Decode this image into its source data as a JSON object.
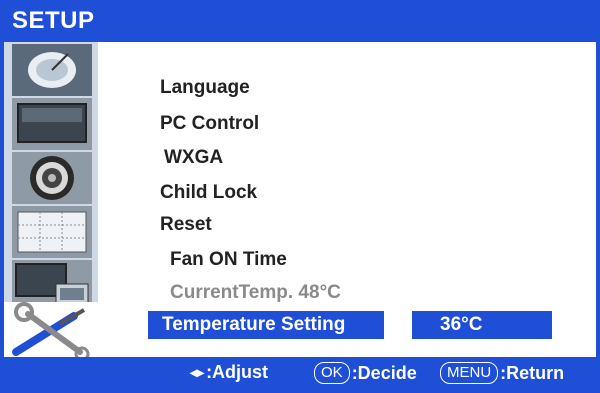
{
  "header": {
    "title": "SETUP"
  },
  "sidebar": {
    "items": [
      {
        "icon": "satellite-dish-icon"
      },
      {
        "icon": "tv-picture-icon"
      },
      {
        "icon": "speaker-icon"
      },
      {
        "icon": "schedule-grid-icon"
      },
      {
        "icon": "pc-monitor-icon"
      },
      {
        "icon": "setup-tools-icon",
        "selected": true
      }
    ]
  },
  "menu": {
    "language": "Language",
    "pc_control": "PC Control",
    "wxga": "WXGA",
    "child_lock": "Child Lock",
    "reset": "Reset",
    "fan_on_time": "Fan ON Time",
    "current_temp": "CurrentTemp. 48°C",
    "temperature_setting": "Temperature Setting",
    "temperature_value": "36°C"
  },
  "footer": {
    "adjust_icon": "◂▸",
    "adjust_label": ":Adjust",
    "ok_key": "OK",
    "decide_label": ":Decide",
    "menu_key": "MENU",
    "return_label": ":Return"
  },
  "colors": {
    "accent": "#1f4fd6",
    "sidebar": "#cfd8e4",
    "dim_text": "#8a8a8a"
  }
}
